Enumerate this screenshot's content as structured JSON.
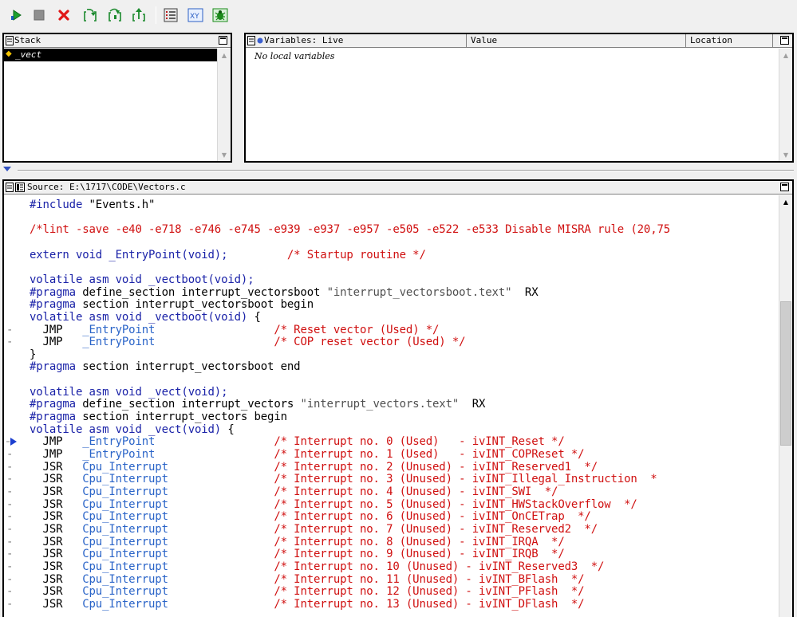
{
  "toolbar": {
    "buttons": [
      {
        "name": "run-icon",
        "label": "Start/Continue",
        "color": "#1ca02e"
      },
      {
        "name": "halt-icon",
        "label": "Halt",
        "color": "#909090"
      },
      {
        "name": "reset-icon",
        "label": "Reset",
        "color": "#e01818"
      },
      {
        "name": "step-into-icon",
        "label": "Step Into",
        "color": "#1c8a2e"
      },
      {
        "name": "step-over-icon",
        "label": "Step Over",
        "color": "#1c8a2e"
      },
      {
        "name": "step-out-icon",
        "label": "Step Out",
        "color": "#1c8a2e"
      },
      {
        "name": "register-window-icon",
        "label": "Registers",
        "color": "#b02020"
      },
      {
        "name": "memory-xy-icon",
        "label": "XY",
        "color": "#2b5fc4"
      },
      {
        "name": "bug-icon",
        "label": "Debug",
        "color": "#1a8a1a"
      }
    ],
    "xy_text": "XY"
  },
  "stack": {
    "title": "Stack",
    "frames": [
      "_vect"
    ]
  },
  "variables": {
    "title": "Variables: Live",
    "columns": [
      "Value",
      "Location"
    ],
    "empty_message": "No local variables"
  },
  "source": {
    "title": "Source: E:\\1717\\CODE\\Vectors.c"
  },
  "colors": {
    "keyword": "#1a22a8",
    "comment": "#d01010",
    "string": "#505050",
    "symbol": "#2a64c8"
  },
  "code_lines": [
    {
      "gutter": "",
      "segments": [
        {
          "t": "#include ",
          "c": "blue"
        },
        {
          "t": "\"Events.h\"",
          "c": "blk"
        }
      ]
    },
    {
      "gutter": "",
      "segments": []
    },
    {
      "gutter": "",
      "segments": [
        {
          "t": "/*lint -save -e40 -e718 -e746 -e745 -e939 -e937 -e957 -e505 -e522 -e533 Disable MISRA rule (20,75",
          "c": "red"
        }
      ]
    },
    {
      "gutter": "",
      "segments": []
    },
    {
      "gutter": "",
      "segments": [
        {
          "t": "extern void _EntryPoint(void);         ",
          "c": "blue"
        },
        {
          "t": "/* Startup routine */",
          "c": "red"
        }
      ]
    },
    {
      "gutter": "",
      "segments": []
    },
    {
      "gutter": "",
      "segments": [
        {
          "t": "volatile asm void _vectboot(void);",
          "c": "blue"
        }
      ]
    },
    {
      "gutter": "",
      "segments": [
        {
          "t": "#pragma ",
          "c": "blue"
        },
        {
          "t": "define_section interrupt_vectorsboot ",
          "c": "blk"
        },
        {
          "t": "\"interrupt_vectorsboot.text\"",
          "c": "str"
        },
        {
          "t": "  RX",
          "c": "blk"
        }
      ]
    },
    {
      "gutter": "",
      "segments": [
        {
          "t": "#pragma ",
          "c": "blue"
        },
        {
          "t": "section interrupt_vectorsboot begin",
          "c": "blk"
        }
      ]
    },
    {
      "gutter": "",
      "segments": [
        {
          "t": "volatile asm void _vectboot(void) ",
          "c": "blue"
        },
        {
          "t": "{",
          "c": "blk"
        }
      ]
    },
    {
      "gutter": "-",
      "segments": [
        {
          "t": "  JMP   ",
          "c": "blk"
        },
        {
          "t": "_EntryPoint",
          "c": "sym"
        },
        {
          "t": "                  ",
          "c": "blk"
        },
        {
          "t": "/* Reset vector (Used) */",
          "c": "red"
        }
      ]
    },
    {
      "gutter": "-",
      "segments": [
        {
          "t": "  JMP   ",
          "c": "blk"
        },
        {
          "t": "_EntryPoint",
          "c": "sym"
        },
        {
          "t": "                  ",
          "c": "blk"
        },
        {
          "t": "/* COP reset vector (Used) */",
          "c": "red"
        }
      ]
    },
    {
      "gutter": "",
      "segments": [
        {
          "t": "}",
          "c": "blk"
        }
      ]
    },
    {
      "gutter": "",
      "segments": [
        {
          "t": "#pragma ",
          "c": "blue"
        },
        {
          "t": "section interrupt_vectorsboot end",
          "c": "blk"
        }
      ]
    },
    {
      "gutter": "",
      "segments": []
    },
    {
      "gutter": "",
      "segments": [
        {
          "t": "volatile asm void _vect(void);",
          "c": "blue"
        }
      ]
    },
    {
      "gutter": "",
      "segments": [
        {
          "t": "#pragma ",
          "c": "blue"
        },
        {
          "t": "define_section interrupt_vectors ",
          "c": "blk"
        },
        {
          "t": "\"interrupt_vectors.text\"",
          "c": "str"
        },
        {
          "t": "  RX",
          "c": "blk"
        }
      ]
    },
    {
      "gutter": "",
      "segments": [
        {
          "t": "#pragma ",
          "c": "blue"
        },
        {
          "t": "section interrupt_vectors begin",
          "c": "blk"
        }
      ]
    },
    {
      "gutter": "",
      "segments": [
        {
          "t": "volatile asm void _vect(void) ",
          "c": "blue"
        },
        {
          "t": "{",
          "c": "blk"
        }
      ]
    },
    {
      "gutter": "pc",
      "segments": [
        {
          "t": "  JMP   ",
          "c": "blk"
        },
        {
          "t": "_EntryPoint",
          "c": "sym"
        },
        {
          "t": "                  ",
          "c": "blk"
        },
        {
          "t": "/* Interrupt no. 0 (Used)   - ivINT_Reset */",
          "c": "red"
        }
      ]
    },
    {
      "gutter": "-",
      "segments": [
        {
          "t": "  JMP   ",
          "c": "blk"
        },
        {
          "t": "_EntryPoint",
          "c": "sym"
        },
        {
          "t": "                  ",
          "c": "blk"
        },
        {
          "t": "/* Interrupt no. 1 (Used)   - ivINT_COPReset */",
          "c": "red"
        }
      ]
    },
    {
      "gutter": "-",
      "segments": [
        {
          "t": "  JSR   ",
          "c": "blk"
        },
        {
          "t": "Cpu_Interrupt",
          "c": "sym"
        },
        {
          "t": "                ",
          "c": "blk"
        },
        {
          "t": "/* Interrupt no. 2 (Unused) - ivINT_Reserved1  */",
          "c": "red"
        }
      ]
    },
    {
      "gutter": "-",
      "segments": [
        {
          "t": "  JSR   ",
          "c": "blk"
        },
        {
          "t": "Cpu_Interrupt",
          "c": "sym"
        },
        {
          "t": "                ",
          "c": "blk"
        },
        {
          "t": "/* Interrupt no. 3 (Unused) - ivINT_Illegal_Instruction  *",
          "c": "red"
        }
      ]
    },
    {
      "gutter": "-",
      "segments": [
        {
          "t": "  JSR   ",
          "c": "blk"
        },
        {
          "t": "Cpu_Interrupt",
          "c": "sym"
        },
        {
          "t": "                ",
          "c": "blk"
        },
        {
          "t": "/* Interrupt no. 4 (Unused) - ivINT_SWI  */",
          "c": "red"
        }
      ]
    },
    {
      "gutter": "-",
      "segments": [
        {
          "t": "  JSR   ",
          "c": "blk"
        },
        {
          "t": "Cpu_Interrupt",
          "c": "sym"
        },
        {
          "t": "                ",
          "c": "blk"
        },
        {
          "t": "/* Interrupt no. 5 (Unused) - ivINT_HWStackOverflow  */",
          "c": "red"
        }
      ]
    },
    {
      "gutter": "-",
      "segments": [
        {
          "t": "  JSR   ",
          "c": "blk"
        },
        {
          "t": "Cpu_Interrupt",
          "c": "sym"
        },
        {
          "t": "                ",
          "c": "blk"
        },
        {
          "t": "/* Interrupt no. 6 (Unused) - ivINT_OnCETrap  */",
          "c": "red"
        }
      ]
    },
    {
      "gutter": "-",
      "segments": [
        {
          "t": "  JSR   ",
          "c": "blk"
        },
        {
          "t": "Cpu_Interrupt",
          "c": "sym"
        },
        {
          "t": "                ",
          "c": "blk"
        },
        {
          "t": "/* Interrupt no. 7 (Unused) - ivINT_Reserved2  */",
          "c": "red"
        }
      ]
    },
    {
      "gutter": "-",
      "segments": [
        {
          "t": "  JSR   ",
          "c": "blk"
        },
        {
          "t": "Cpu_Interrupt",
          "c": "sym"
        },
        {
          "t": "                ",
          "c": "blk"
        },
        {
          "t": "/* Interrupt no. 8 (Unused) - ivINT_IRQA  */",
          "c": "red"
        }
      ]
    },
    {
      "gutter": "-",
      "segments": [
        {
          "t": "  JSR   ",
          "c": "blk"
        },
        {
          "t": "Cpu_Interrupt",
          "c": "sym"
        },
        {
          "t": "                ",
          "c": "blk"
        },
        {
          "t": "/* Interrupt no. 9 (Unused) - ivINT_IRQB  */",
          "c": "red"
        }
      ]
    },
    {
      "gutter": "-",
      "segments": [
        {
          "t": "  JSR   ",
          "c": "blk"
        },
        {
          "t": "Cpu_Interrupt",
          "c": "sym"
        },
        {
          "t": "                ",
          "c": "blk"
        },
        {
          "t": "/* Interrupt no. 10 (Unused) - ivINT_Reserved3  */",
          "c": "red"
        }
      ]
    },
    {
      "gutter": "-",
      "segments": [
        {
          "t": "  JSR   ",
          "c": "blk"
        },
        {
          "t": "Cpu_Interrupt",
          "c": "sym"
        },
        {
          "t": "                ",
          "c": "blk"
        },
        {
          "t": "/* Interrupt no. 11 (Unused) - ivINT_BFlash  */",
          "c": "red"
        }
      ]
    },
    {
      "gutter": "-",
      "segments": [
        {
          "t": "  JSR   ",
          "c": "blk"
        },
        {
          "t": "Cpu_Interrupt",
          "c": "sym"
        },
        {
          "t": "                ",
          "c": "blk"
        },
        {
          "t": "/* Interrupt no. 12 (Unused) - ivINT_PFlash  */",
          "c": "red"
        }
      ]
    },
    {
      "gutter": "-",
      "segments": [
        {
          "t": "  JSR   ",
          "c": "blk"
        },
        {
          "t": "Cpu_Interrupt",
          "c": "sym"
        },
        {
          "t": "                ",
          "c": "blk"
        },
        {
          "t": "/* Interrupt no. 13 (Unused) - ivINT_DFlash  */",
          "c": "red"
        }
      ]
    }
  ]
}
